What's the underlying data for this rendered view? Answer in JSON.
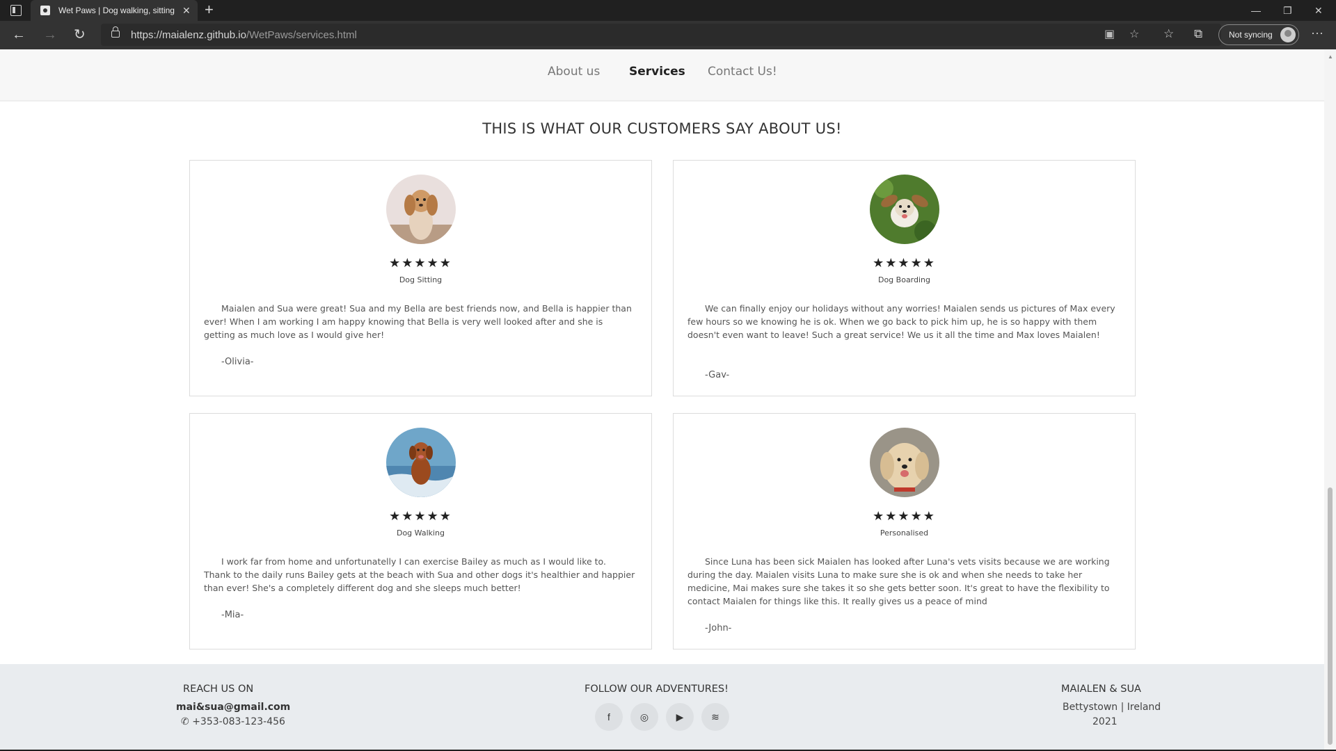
{
  "browser": {
    "tab_title": "Wet Paws | Dog walking, sitting a",
    "url_main": "https://maialenz.github.io",
    "url_path": "/WetPaws/services.html",
    "sync_label": "Not syncing"
  },
  "nav": {
    "about": "About us",
    "services": "Services",
    "contact": "Contact Us!"
  },
  "section_title": "THIS IS WHAT OUR CUSTOMERS SAY ABOUT US!",
  "reviews": [
    {
      "stars": "★★★★★",
      "rating": 5,
      "service": "Dog Sitting",
      "quote": "Maialen and Sua were great! Sua and my Bella are best friends now, and Bella is happier than ever! When I am working I am happy knowing that Bella is very well looked after and she is getting as much love as I would give her!",
      "author": "-Olivia-"
    },
    {
      "stars": "★★★★★",
      "rating": 5,
      "service": "Dog Boarding",
      "quote": "We can finally enjoy our holidays without any worries! Maialen sends us pictures of Max every few hours so we knowing he is ok. When we go back to pick him up, he is so happy with them doesn't even want to leave! Such a great service! We us it all the time and Max loves Maialen!",
      "author": "-Gav-"
    },
    {
      "stars": "★★★★★",
      "rating": 5,
      "service": "Dog Walking",
      "quote": "I work far from home and unfortunatelly I can exercise Bailey as much as I would like to. Thank to the daily runs Bailey gets at the beach with Sua and other dogs it's healthier and happier than ever! She's a completely different dog and she sleeps much better!",
      "author": "-Mia-"
    },
    {
      "stars": "★★★★★",
      "rating": 5,
      "service": "Personalised",
      "quote": "Since Luna has been sick Maialen has looked after Luna's vets visits because we are working during the day. Maialen visits Luna to make sure she is ok and when she needs to take her medicine, Mai makes sure she takes it so she gets better soon. It's great to have the flexibility to contact Maialen for things like this. It really gives us a peace of mind",
      "author": "-John-"
    }
  ],
  "footer": {
    "reach_heading": "REACH US ON",
    "email": "mai&sua@gmail.com",
    "phone": "+353-083-123-456",
    "follow_heading": "FOLLOW OUR ADVENTURES!",
    "brand_heading": "MAIALEN & SUA",
    "location": "Bettystown | Ireland",
    "year": "2021",
    "social_icons": [
      "facebook-icon",
      "instagram-icon",
      "youtube-icon",
      "spotify-icon"
    ]
  }
}
